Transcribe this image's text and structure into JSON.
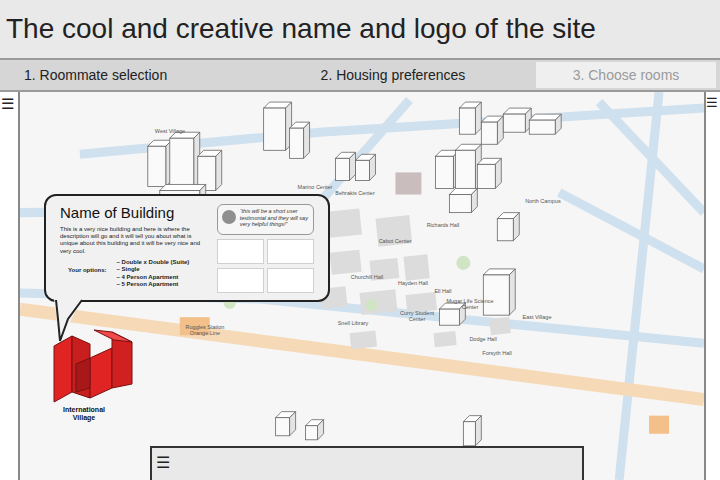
{
  "header": {
    "title": "The cool and creative name and logo of the site"
  },
  "steps": [
    {
      "label": "1. Roommate selection",
      "selected": false
    },
    {
      "label": "2. Housing preferences",
      "selected": false
    },
    {
      "label": "3. Choose rooms",
      "selected": true
    }
  ],
  "menus": {
    "left": "☰",
    "right": "☰",
    "bottom": "☰"
  },
  "map": {
    "labels": [
      "West Village",
      "Marino Center",
      "Behrakis Center",
      "Cabot Center",
      "North Campus",
      "Richards Hall",
      "Churchill Hall",
      "Hayden Hall",
      "Ell Hall",
      "Snell Library",
      "Curry Student Center",
      "Mugar Life Science Center",
      "Dodge Hall",
      "East Village",
      "Forsyth Hall",
      "Ruggles Station Orange Line"
    ]
  },
  "popup": {
    "title": "Name of Building",
    "description": "This is a very nice building and here is where the description will go and it will tell you about what is unique about this building and it will be very nice and very cool.",
    "options_label": "Your options:",
    "options": [
      "– Double x Double (Suite)",
      "– Single",
      "– 4 Person Apartment",
      "– 5 Person Apartment"
    ],
    "testimonial": "“this will be a short user testimonial and they will say very helpful things!”"
  },
  "selected_building": {
    "label": "International Village",
    "highlighted": true
  }
}
